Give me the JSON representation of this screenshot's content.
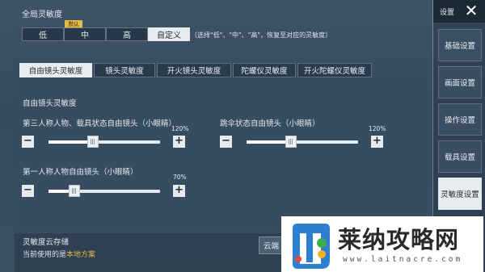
{
  "global": {
    "title": "全局灵敏度",
    "badge": "默认",
    "options": [
      "低",
      "中",
      "高",
      "自定义"
    ],
    "selected": "自定义",
    "hint": "（选择\"低\"、\"中\"、\"高\"，恢复至对应的灵敏度）"
  },
  "tabs": [
    "自由镜头灵敏度",
    "镜头灵敏度",
    "开火镜头灵敏度",
    "陀螺仪灵敏度",
    "开火陀螺仪灵敏度"
  ],
  "active_tab": "自由镜头灵敏度",
  "section": {
    "title": "自由镜头灵敏度",
    "sliders": [
      {
        "label": "第三人称人物、载具状态自由镜头（小眼睛）",
        "value_text": "120%",
        "value": 120
      },
      {
        "label": "跳伞状态自由镜头（小眼睛）",
        "value_text": "120%",
        "value": 120
      },
      {
        "label": "第一人称人物自由镜头（小眼睛）",
        "value_text": "70%",
        "value": 70
      }
    ],
    "minus": "−",
    "plus": "+"
  },
  "cloud": {
    "title": "灵敏度云存储",
    "current_prefix": "当前使用的是",
    "current_value": "本地方案",
    "button": "云端"
  },
  "sidebar": {
    "title": "设置",
    "close": "✕",
    "items": [
      "基础设置",
      "画面设置",
      "操作设置",
      "载具设置",
      "灵敏度设置"
    ],
    "active": "灵敏度设置"
  },
  "watermark": {
    "text": "莱纳攻略网",
    "url": "www.laitnacre.com"
  },
  "colors": {
    "accent": "#e2b84a",
    "active_bg": "#e9ecef"
  }
}
